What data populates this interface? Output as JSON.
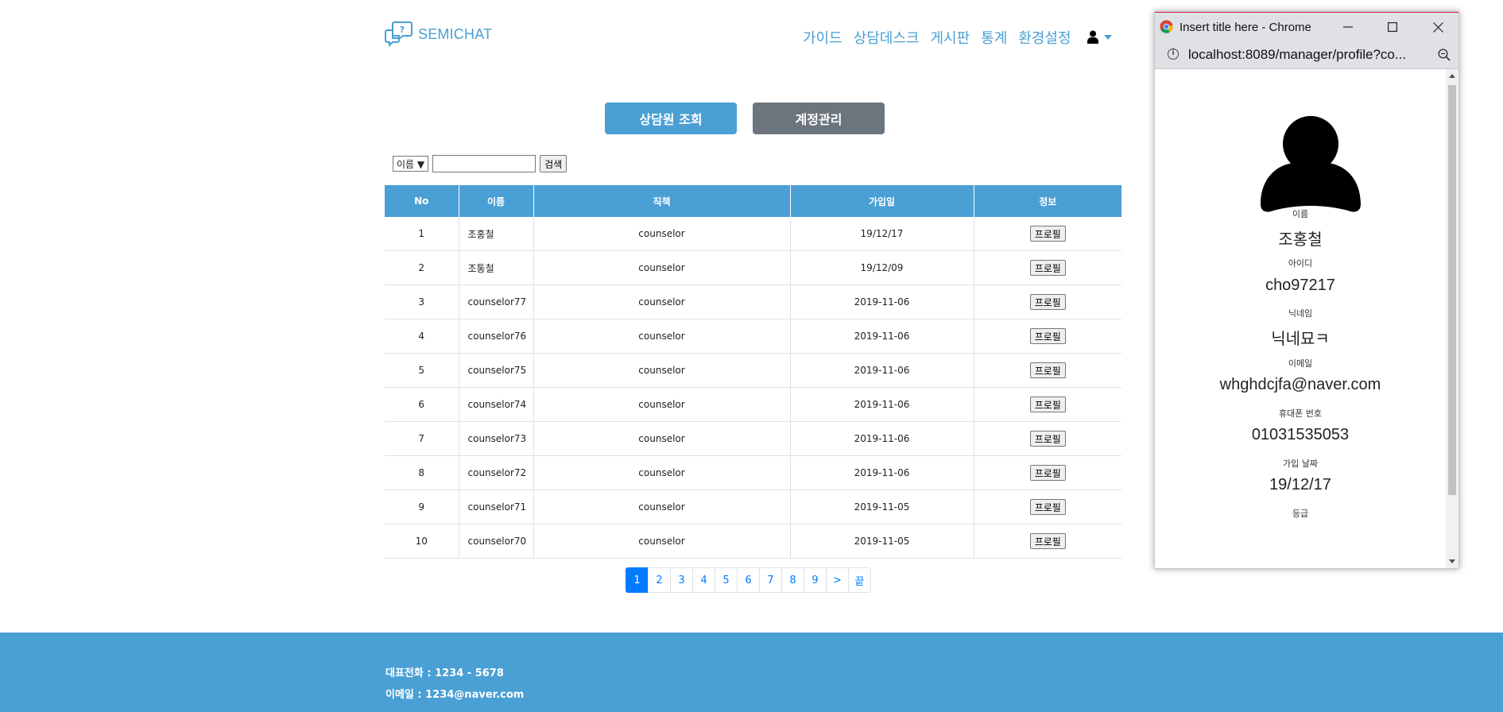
{
  "header": {
    "logo_text": "SEMICHAT",
    "nav": [
      "가이드",
      "상담데스크",
      "게시판",
      "통계",
      "환경설정"
    ]
  },
  "tabs": {
    "counselor_lookup": "상담원 조회",
    "account_manage": "계정관리"
  },
  "search": {
    "select_value": "이름 ▼",
    "input_value": "",
    "button_label": "검색"
  },
  "table": {
    "columns": [
      "No",
      "이름",
      "직책",
      "가입일",
      "정보"
    ],
    "profile_button": "프로필",
    "rows": [
      {
        "no": "1",
        "name": "조홍철",
        "role": "counselor",
        "joined": "19/12/17"
      },
      {
        "no": "2",
        "name": "조통철",
        "role": "counselor",
        "joined": "19/12/09"
      },
      {
        "no": "3",
        "name": "counselor77",
        "role": "counselor",
        "joined": "2019-11-06"
      },
      {
        "no": "4",
        "name": "counselor76",
        "role": "counselor",
        "joined": "2019-11-06"
      },
      {
        "no": "5",
        "name": "counselor75",
        "role": "counselor",
        "joined": "2019-11-06"
      },
      {
        "no": "6",
        "name": "counselor74",
        "role": "counselor",
        "joined": "2019-11-06"
      },
      {
        "no": "7",
        "name": "counselor73",
        "role": "counselor",
        "joined": "2019-11-06"
      },
      {
        "no": "8",
        "name": "counselor72",
        "role": "counselor",
        "joined": "2019-11-06"
      },
      {
        "no": "9",
        "name": "counselor71",
        "role": "counselor",
        "joined": "2019-11-05"
      },
      {
        "no": "10",
        "name": "counselor70",
        "role": "counselor",
        "joined": "2019-11-05"
      }
    ]
  },
  "pagination": {
    "pages": [
      "1",
      "2",
      "3",
      "4",
      "5",
      "6",
      "7",
      "8",
      "9"
    ],
    "active": "1",
    "next": ">",
    "last": "끝"
  },
  "footer": {
    "phone": "대표전화 : 1234 - 5678",
    "email": "이메일 : 1234@naver.com"
  },
  "popup": {
    "window_title": "Insert title here - Chrome",
    "url": "localhost:8089/manager/profile?co...",
    "fields": [
      {
        "label": "이름",
        "value": "조홍철"
      },
      {
        "label": "아이디",
        "value": "cho97217"
      },
      {
        "label": "닉네임",
        "value": "닉네묘ㅋ"
      },
      {
        "label": "이메일",
        "value": "whghdcjfa@naver.com"
      },
      {
        "label": "휴대폰 번호",
        "value": "01031535053"
      },
      {
        "label": "가입 날짜",
        "value": "19/12/17"
      },
      {
        "label": "등급",
        "value": ""
      }
    ]
  },
  "colors": {
    "brand": "#4a9fd4",
    "secondary": "#6c757d",
    "link": "#007bff"
  },
  "icons": {
    "logo": "chat-question-icon",
    "user": "user-icon",
    "avatar": "user-silhouette-icon"
  }
}
